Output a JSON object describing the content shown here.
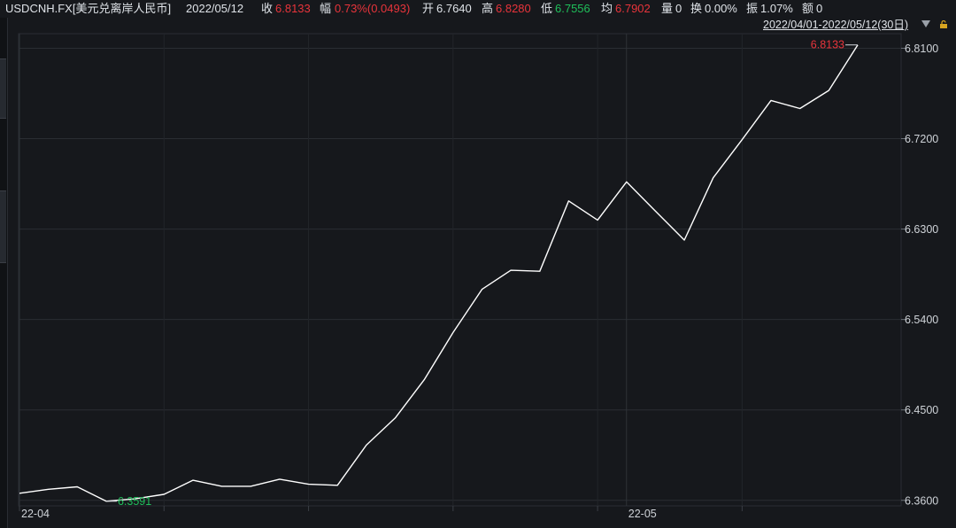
{
  "header": {
    "symbol": "USDCNH.FX[美元兑离岸人民币]",
    "date": "2022/05/12",
    "close_label": "收",
    "close_value": "6.8133",
    "change_label": "幅",
    "change_value": "0.73%(0.0493)",
    "open_label": "开",
    "open_value": "6.7640",
    "high_label": "高",
    "high_value": "6.8280",
    "low_label": "低",
    "low_value": "6.7556",
    "avg_label": "均",
    "avg_value": "6.7902",
    "volume_label": "量",
    "volume_value": "0",
    "turnover_label": "换",
    "turnover_value": "0.00%",
    "amplitude_label": "振",
    "amplitude_value": "1.07%",
    "amount_label": "额",
    "amount_value": "0"
  },
  "range_selector": "2022/04/01-2022/05/12(30日)",
  "icons": {
    "dropdown": "chevron-down-icon",
    "lock": "lock-icon"
  },
  "colors": {
    "up": "#e8343b",
    "down": "#1fbf5a",
    "line": "#ffffff",
    "background": "#16181c"
  },
  "chart_data": {
    "type": "line",
    "x_ticks": [
      "22-04",
      "22-05"
    ],
    "y_ticks": [
      "6.8100",
      "6.7200",
      "6.6300",
      "6.5400",
      "6.4500",
      "6.3600"
    ],
    "ylim": [
      6.3545,
      6.8245
    ],
    "max_label": "6.8133",
    "min_label": "6.3591",
    "x": [
      "2022-04-01",
      "2022-04-04",
      "2022-04-05",
      "2022-04-06",
      "2022-04-07",
      "2022-04-08",
      "2022-04-11",
      "2022-04-12",
      "2022-04-13",
      "2022-04-14",
      "2022-04-15",
      "2022-04-18",
      "2022-04-19",
      "2022-04-20",
      "2022-04-21",
      "2022-04-22",
      "2022-04-25",
      "2022-04-26",
      "2022-04-27",
      "2022-04-28",
      "2022-04-29",
      "2022-05-02",
      "2022-05-03",
      "2022-05-04",
      "2022-05-05",
      "2022-05-06",
      "2022-05-09",
      "2022-05-10",
      "2022-05-11",
      "2022-05-12"
    ],
    "series": [
      {
        "values": [
          6.367,
          6.371,
          6.3735,
          6.3591,
          6.3615,
          6.366,
          6.38,
          6.374,
          6.374,
          6.381,
          6.376,
          6.375,
          6.415,
          6.442,
          6.48,
          6.527,
          6.57,
          6.589,
          6.588,
          6.658,
          6.639,
          6.677,
          6.648,
          6.619,
          6.681,
          6.719,
          6.758,
          6.75,
          6.768,
          6.8133
        ]
      }
    ],
    "grid": true
  }
}
